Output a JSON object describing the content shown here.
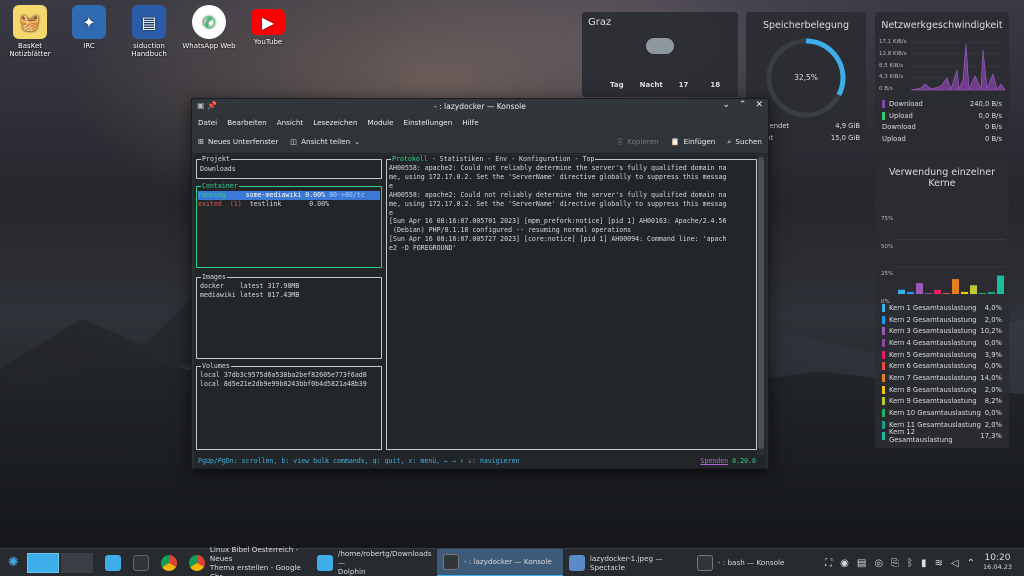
{
  "desktop_icons": [
    {
      "label": "BasKet\nNotizblätter",
      "icon": "basket-icon"
    },
    {
      "label": "IRC",
      "icon": "irc-icon"
    },
    {
      "label": "siduction\nHandbuch",
      "icon": "book-icon"
    },
    {
      "label": "WhatsApp Web",
      "icon": "whatsapp-icon"
    },
    {
      "label": "YouTube",
      "icon": "youtube-icon"
    }
  ],
  "weather": {
    "city": "Graz",
    "day_label": "Tag",
    "night_label": "Nacht",
    "day_temp": "17",
    "night_temp": "18"
  },
  "memory": {
    "title": "Speicherbelegung",
    "percent_label": "32,5%",
    "percent": 32.5,
    "rows": [
      {
        "label": "wendet",
        "value": "4,9 GiB"
      },
      {
        "label": "mt",
        "value": "15,0 GiB"
      }
    ]
  },
  "network": {
    "title": "Netzwerkgeschwindigkeit",
    "ticks": [
      "17,1 KiB/s",
      "12,8 KiB/s",
      "8,5 KiB/s",
      "4,3 KiB/s",
      "0 B/s"
    ],
    "rows": [
      {
        "label": "Download",
        "value": "240,0 B/s",
        "color": "#8e44ad"
      },
      {
        "label": "Upload",
        "value": "0,0 B/s",
        "color": "#2ecc71"
      },
      {
        "label": "Download",
        "value": "0 B/s",
        "color": ""
      },
      {
        "label": "Upload",
        "value": "0 B/s",
        "color": ""
      }
    ]
  },
  "cores": {
    "title": "Verwendung einzelner Kerne",
    "ticks": [
      "75%",
      "50%",
      "25%",
      "0%"
    ],
    "rows": [
      {
        "label": "Kern 1 Gesamtauslastung",
        "value": "4,0%",
        "pct": 4.0,
        "color": "#3daee9"
      },
      {
        "label": "Kern 2 Gesamtauslastung",
        "value": "2,0%",
        "pct": 2.0,
        "color": "#1d99f3"
      },
      {
        "label": "Kern 3 Gesamtauslastung",
        "value": "10,2%",
        "pct": 10.2,
        "color": "#9b59b6"
      },
      {
        "label": "Kern 4 Gesamtauslastung",
        "value": "0,0%",
        "pct": 0.0,
        "color": "#8e44ad"
      },
      {
        "label": "Kern 5 Gesamtauslastung",
        "value": "3,9%",
        "pct": 3.9,
        "color": "#e91e63"
      },
      {
        "label": "Kern 6 Gesamtauslastung",
        "value": "0,0%",
        "pct": 0.0,
        "color": "#e74c3c"
      },
      {
        "label": "Kern 7 Gesamtauslastung",
        "value": "14,0%",
        "pct": 14.0,
        "color": "#e67e22"
      },
      {
        "label": "Kern 8 Gesamtauslastung",
        "value": "2,0%",
        "pct": 2.0,
        "color": "#f1c40f"
      },
      {
        "label": "Kern 9 Gesamtauslastung",
        "value": "8,2%",
        "pct": 8.2,
        "color": "#c0ca33"
      },
      {
        "label": "Kern 10 Gesamtauslastung",
        "value": "0,0%",
        "pct": 0.0,
        "color": "#27ae60"
      },
      {
        "label": "Kern 11 Gesamtauslastung",
        "value": "2,0%",
        "pct": 2.0,
        "color": "#16a085"
      },
      {
        "label": "Kern 12 Gesamtauslastung",
        "value": "17,3%",
        "pct": 17.3,
        "color": "#1abc9c"
      }
    ]
  },
  "konsole": {
    "title": "- : lazydocker — Konsole",
    "menu": [
      "Datei",
      "Bearbeiten",
      "Ansicht",
      "Lesezeichen",
      "Module",
      "Einstellungen",
      "Hilfe"
    ],
    "toolbar": {
      "new_tab": "Neues Unterfenster",
      "split": "Ansicht teilen",
      "copy": "Kopieren",
      "paste": "Einfügen",
      "find": "Suchen"
    },
    "project": {
      "title": "Projekt",
      "value": "Downloads"
    },
    "containers": {
      "title": "Container",
      "rows": [
        {
          "status": "running",
          "name": "some-mediawiki",
          "cpu": "0.00%",
          "ports": "80->80/tc"
        },
        {
          "status": "exited  (1)",
          "name": "testlink",
          "cpu": "0.00%",
          "ports": ""
        }
      ]
    },
    "images": {
      "title": "Images",
      "rows": [
        "docker    latest 317.98MB",
        "mediawiki latest 817.43MB"
      ]
    },
    "volumes": {
      "title": "Volumes",
      "rows": [
        "local 37db3c9575d6a538ba2bef82605e773f6ad8",
        "local 8d5e21e2db9e99b8243bbf0b4d5821a48b39"
      ]
    },
    "log": {
      "tab_active": "Protokoll",
      "tabs_rest": " - Statistiken - Env - Konfiguration - Top",
      "lines": [
        "AH00558: apache2: Could not reliably determine the server's fully qualified domain na",
        "me, using 172.17.0.2. Set the 'ServerName' directive globally to suppress this messag",
        "e",
        "AH00558: apache2: Could not reliably determine the server's fully qualified domain na",
        "me, using 172.17.0.2. Set the 'ServerName' directive globally to suppress this messag",
        "e",
        "[Sun Apr 16 08:16:07.005701 2023] [mpm_prefork:notice] [pid 1] AH00163: Apache/2.4.56",
        " (Debian) PHP/8.1.18 configured -- resuming normal operations",
        "[Sun Apr 16 08:16:07.005727 2023] [core:notice] [pid 1] AH00094: Command line: 'apach",
        "e2 -D FOREGROUND'"
      ]
    },
    "status": "PgUp/PgDn: scrollen, b: view bulk commands, q: quit, x: menü, ← → ↑ ↓: navigieren",
    "donate": "Spenden",
    "version": "0.20.0"
  },
  "taskbar": {
    "tasks": [
      {
        "label": "Linux Bibel Oesterreich - Neues\nThema erstellen - Google Chr...",
        "color": "#db4437"
      },
      {
        "label": "/home/robertg/Downloads —\nDolphin",
        "color": "#3daee9"
      },
      {
        "label": "- : lazydocker — Konsole",
        "color": "#31363b"
      },
      {
        "label": "lazydocker-1.jpeg — Spectacle",
        "color": "#5b8ac8"
      },
      {
        "label": "- : bash — Konsole",
        "color": "#31363b"
      }
    ],
    "time": "10:20",
    "date": "16.04.23"
  }
}
